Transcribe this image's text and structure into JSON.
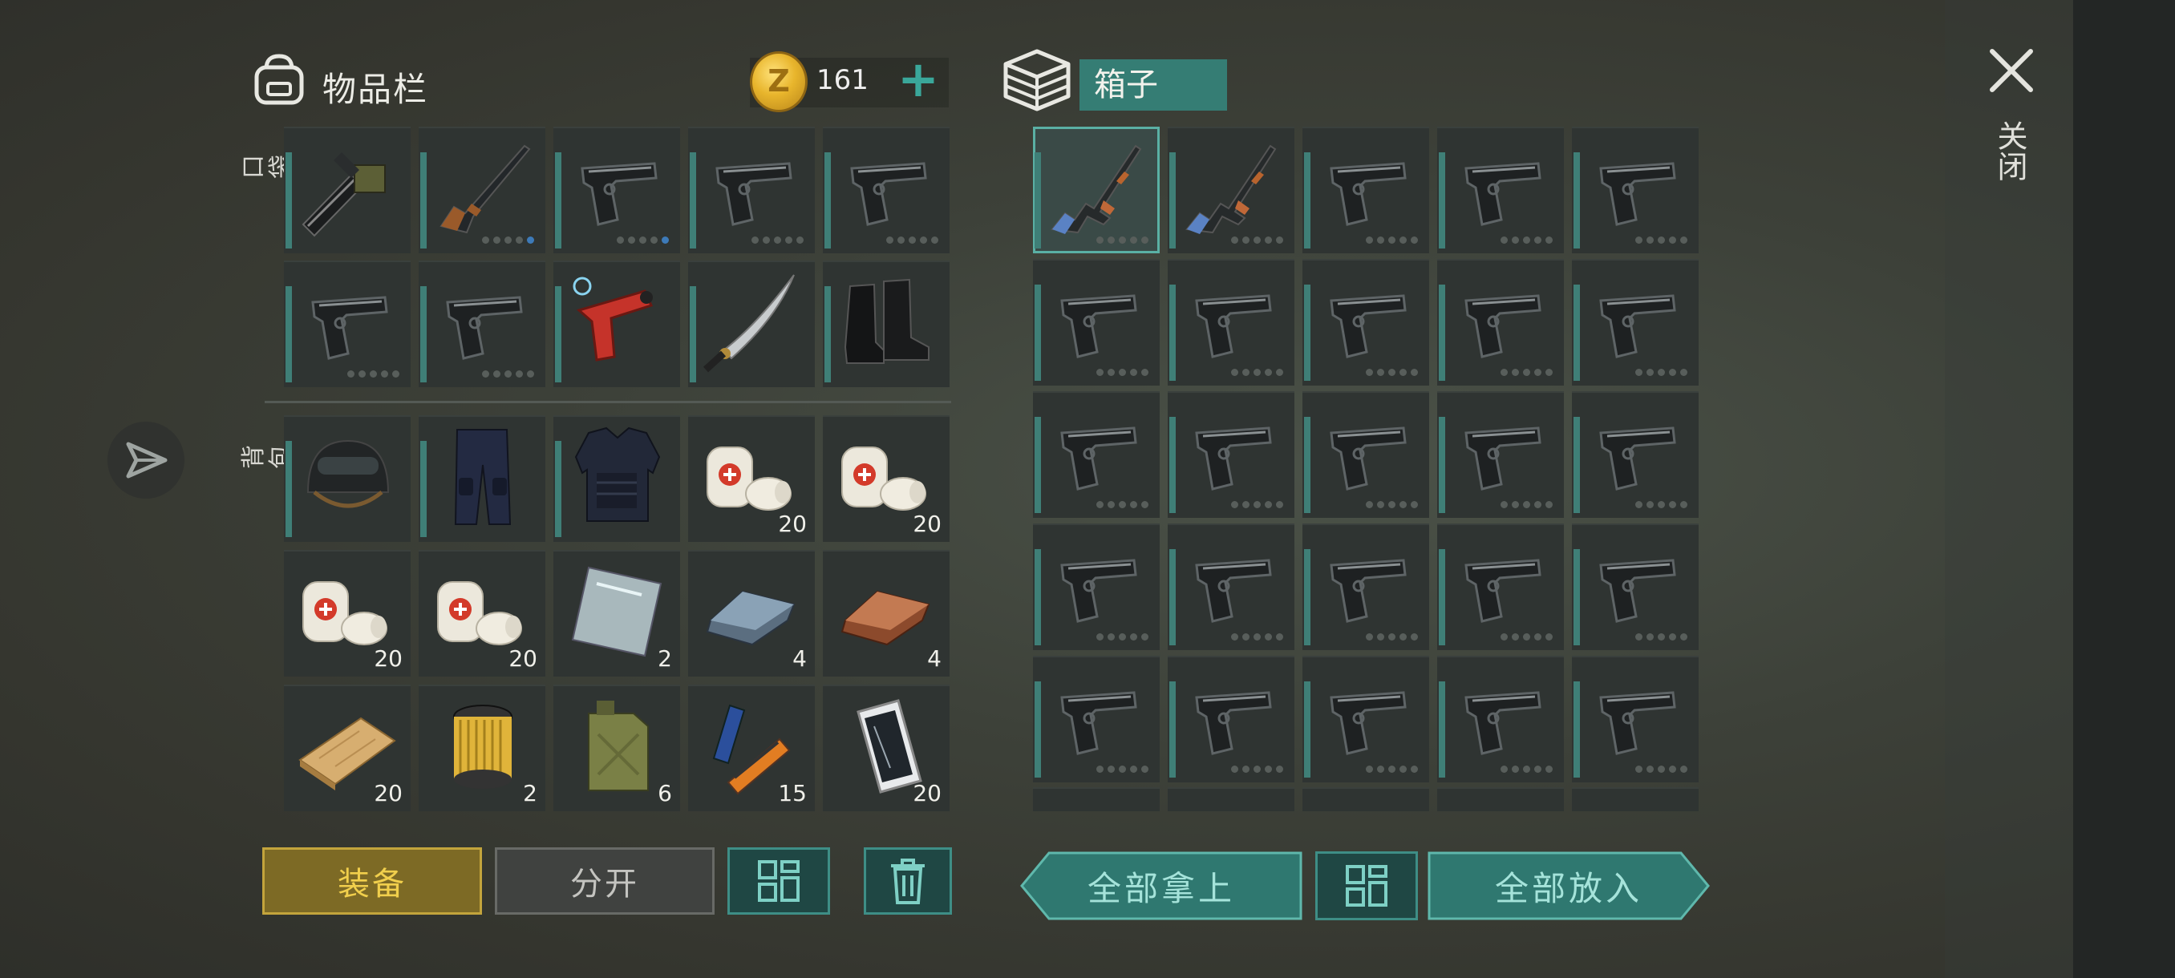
{
  "inventory": {
    "title": "物品栏",
    "coins": "161",
    "pocket_label": "口袋",
    "backpack_label": "背包",
    "pocket_slots": [
      {
        "item": "minigun",
        "durability_dots": 0
      },
      {
        "item": "rifle",
        "durability_dots": 5,
        "active_dot": 5
      },
      {
        "item": "pistol",
        "durability_dots": 5,
        "active_dot": 5
      },
      {
        "item": "pistol",
        "durability_dots": 5
      },
      {
        "item": "pistol",
        "durability_dots": 5
      },
      {
        "item": "pistol",
        "durability_dots": 5
      },
      {
        "item": "pistol",
        "durability_dots": 5
      },
      {
        "item": "flare-gun",
        "durability_dots": 0
      },
      {
        "item": "katana",
        "durability_dots": 0
      },
      {
        "item": "boots",
        "durability_dots": 0
      }
    ],
    "backpack_slots": [
      {
        "item": "helmet",
        "qty": ""
      },
      {
        "item": "pants",
        "qty": ""
      },
      {
        "item": "body-armor",
        "qty": ""
      },
      {
        "item": "bandage",
        "qty": "20"
      },
      {
        "item": "bandage",
        "qty": "20"
      },
      {
        "item": "bandage",
        "qty": "20"
      },
      {
        "item": "bandage",
        "qty": "20"
      },
      {
        "item": "glass-plate",
        "qty": "2"
      },
      {
        "item": "steel-ingot",
        "qty": "4"
      },
      {
        "item": "copper-ingot",
        "qty": "4"
      },
      {
        "item": "wood-plank",
        "qty": "20"
      },
      {
        "item": "air-filter",
        "qty": "2"
      },
      {
        "item": "jerrycan",
        "qty": "6"
      },
      {
        "item": "batteries",
        "qty": "15"
      },
      {
        "item": "smartphone",
        "qty": "20"
      }
    ]
  },
  "box": {
    "title": "箱子",
    "slots": [
      "ak-rifle",
      "ak-rifle",
      "pistol",
      "pistol",
      "pistol",
      "pistol",
      "pistol",
      "pistol",
      "pistol",
      "pistol",
      "pistol",
      "pistol",
      "pistol",
      "pistol",
      "pistol",
      "pistol",
      "pistol",
      "pistol",
      "pistol",
      "pistol",
      "pistol",
      "pistol",
      "pistol",
      "pistol",
      "pistol"
    ]
  },
  "buttons": {
    "equip": "装备",
    "split": "分开",
    "take_all": "全部拿上",
    "put_all": "全部放入"
  },
  "close_label": "关闭",
  "colors": {
    "accent": "#3e8e86",
    "equip": "#c3a43c",
    "coin": "#e8b52c"
  }
}
